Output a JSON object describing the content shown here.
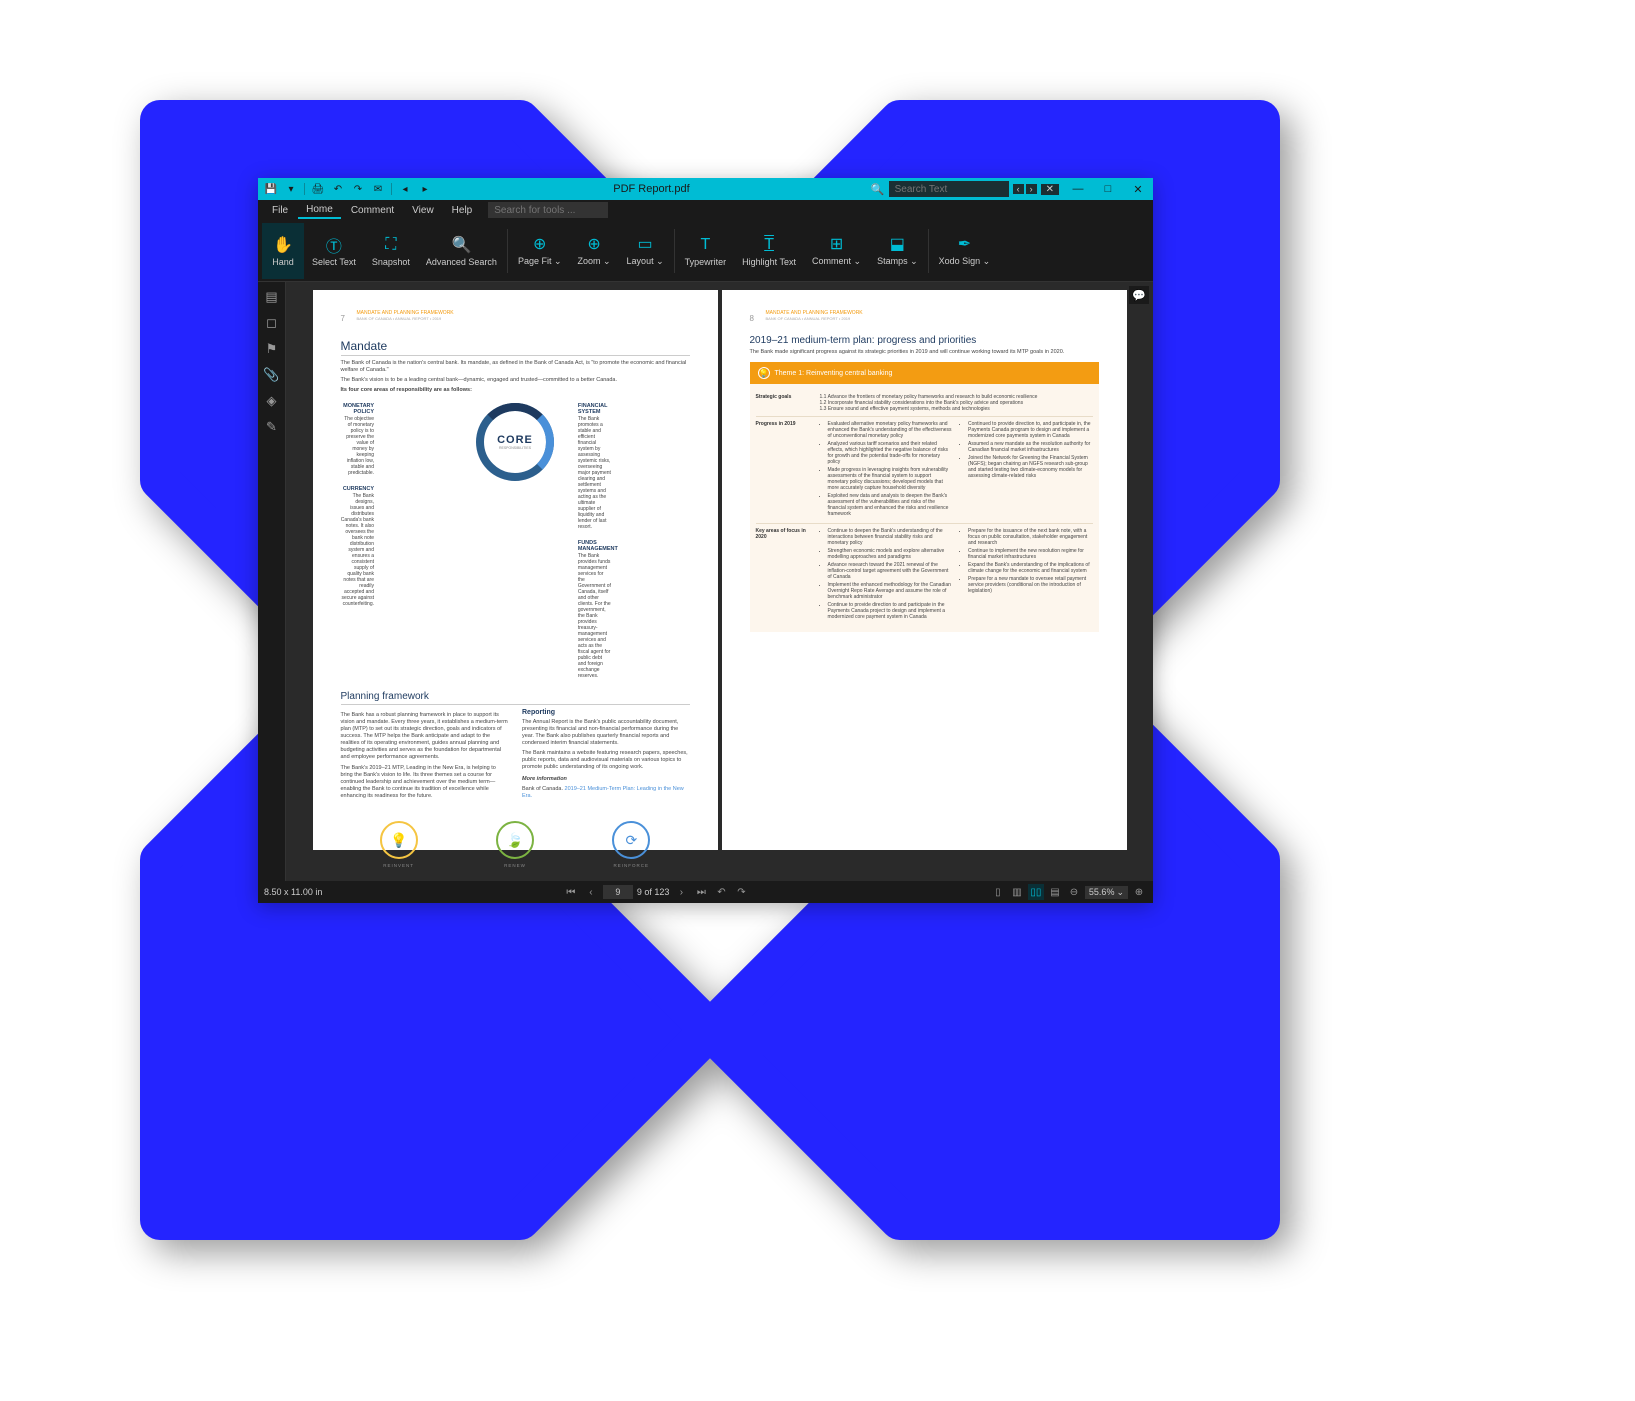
{
  "titlebar": {
    "title": "PDF Report.pdf",
    "search_placeholder": "Search Text"
  },
  "syscontrols": {
    "min": "—",
    "max": "□",
    "close": "✕"
  },
  "menubar": {
    "items": [
      "File",
      "Home",
      "Comment",
      "View",
      "Help"
    ],
    "active": 1,
    "search_placeholder": "Search for tools ..."
  },
  "ribbon": {
    "buttons": [
      {
        "label": "Hand",
        "active": true
      },
      {
        "label": "Select Text"
      },
      {
        "label": "Snapshot"
      },
      {
        "label": "Advanced Search"
      },
      {
        "sep": true
      },
      {
        "label": "Page Fit ⌄"
      },
      {
        "label": "Zoom ⌄"
      },
      {
        "label": "Layout ⌄"
      },
      {
        "sep": true
      },
      {
        "label": "Typewriter"
      },
      {
        "label": "Highlight Text"
      },
      {
        "label": "Comment ⌄"
      },
      {
        "label": "Stamps ⌄"
      },
      {
        "sep": true
      },
      {
        "label": "Xodo Sign ⌄"
      }
    ]
  },
  "page_left": {
    "num": "7",
    "header": "MANDATE AND PLANNING FRAMEWORK",
    "sub": "BANK OF CANADA  •  ANNUAL REPORT  •  2019",
    "h1": "Mandate",
    "p1": "The Bank of Canada is the nation's central bank. Its mandate, as defined in the Bank of Canada Act, is \"to promote the economic and financial welfare of Canada.\"",
    "p2": "The Bank's vision is to be a leading central bank—dynamic, engaged and trusted—committed to a better Canada.",
    "p3": "Its four core areas of responsibility are as follows:",
    "core": {
      "mp_h": "MONETARY POLICY",
      "mp_t": "The objective of monetary policy is to preserve the value of money by keeping inflation low, stable and predictable.",
      "fs_h": "FINANCIAL SYSTEM",
      "fs_t": "The Bank promotes a stable and efficient financial system by assessing systemic risks, overseeing major payment clearing and settlement systems and acting as the ultimate supplier of liquidity and lender of last resort.",
      "cu_h": "CURRENCY",
      "cu_t": "The Bank designs, issues and distributes Canada's bank notes. It also oversees the bank note distribution system and ensures a consistent supply of quality bank notes that are readily accepted and secure against counterfeiting.",
      "fm_h": "FUNDS MANAGEMENT",
      "fm_t": "The Bank provides funds management services for the Government of Canada, itself and other clients. For the government, the Bank provides treasury-management services and acts as the fiscal agent for public debt and foreign exchange reserves.",
      "title": "CORE",
      "sub": "RESPONSIBILITIES"
    },
    "h2": "Planning framework",
    "plan_p1": "The Bank has a robust planning framework in place to support its vision and mandate. Every three years, it establishes a medium-term plan (MTP) to set out its strategic direction, goals and indicators of success. The MTP helps the Bank anticipate and adapt to the realities of its operating environment, guides annual planning and budgeting activities and serves as the foundation for departmental and employee performance agreements.",
    "plan_p2": "The Bank's 2019–21 MTP, Leading in the New Era, is helping to bring the Bank's vision to life. Its three themes set a course for continued leadership and achievement over the medium term—enabling the Bank to continue its tradition of excellence while enhancing its readiness for the future.",
    "rep_h": "Reporting",
    "rep_p1": "The Annual Report is the Bank's public accountability document, presenting its financial and non-financial performance during the year. The Bank also publishes quarterly financial reports and condensed interim financial statements.",
    "rep_p2": "The Bank maintains a website featuring research papers, speeches, public reports, data and audiovisual materials on various topics to promote public understanding of its ongoing work.",
    "more_h": "More information",
    "more_t": "Bank of Canada. ",
    "more_link": "2019–21 Medium-Term Plan: Leading in the New Era.",
    "icons": [
      "REINVENT",
      "RENEW",
      "REINFORCE"
    ]
  },
  "page_right": {
    "num": "8",
    "header": "MANDATE AND PLANNING FRAMEWORK",
    "sub": "BANK OF CANADA  •  ANNUAL REPORT  •  2019",
    "h1": "2019–21 medium-term plan: progress and priorities",
    "p1": "The Bank made significant progress against its strategic priorities in 2019 and will continue working toward its MTP goals in 2020.",
    "theme": "Theme 1: Reinventing central banking",
    "rows": [
      {
        "label": "Strategic goals",
        "single": "1.1 Advance the frontiers of monetary policy frameworks and research to build economic resilience\n1.2 Incorporate financial stability considerations into the Bank's policy advice and operations\n1.3 Ensure sound and effective payment systems, methods and technologies"
      },
      {
        "label": "Progress in 2019",
        "col1": [
          "Evaluated alternative monetary policy frameworks and enhanced the Bank's understanding of the effectiveness of unconventional monetary policy",
          "Analyzed various tariff scenarios and their related effects, which highlighted the negative balance of risks for growth and the potential trade-offs for monetary policy",
          "Made progress in leveraging insights from vulnerability assessments of the financial system to support monetary policy discussions; developed models that more accurately capture household diversity",
          "Exploited new data and analysis to deepen the Bank's assessment of the vulnerabilities and risks of the financial system and enhanced the risks and resilience framework"
        ],
        "col2": [
          "Continued to provide direction to, and participate in, the Payments Canada program to design and implement a modernized core payments system in Canada",
          "Assumed a new mandate as the resolution authority for Canadian financial market infrastructures",
          "Joined the Network for Greening the Financial System (NGFS); began chairing an NGFS research sub-group and started testing two climate-economy models for assessing climate-related risks"
        ]
      },
      {
        "label": "Key areas of focus in 2020",
        "col1": [
          "Continue to deepen the Bank's understanding of the interactions between financial stability risks and monetary policy",
          "Strengthen economic models and explore alternative modelling approaches and paradigms",
          "Advance research toward the 2021 renewal of the inflation-control target agreement with the Government of Canada",
          "Implement the enhanced methodology for the Canadian Overnight Repo Rate Average and assume the role of benchmark administrator",
          "Continue to provide direction to and participate in the Payments Canada project to design and implement a modernized core payment system in Canada"
        ],
        "col2": [
          "Prepare for the issuance of the next bank note, with a focus on public consultation, stakeholder engagement and research",
          "Continue to implement the new resolution regime for financial market infrastructures",
          "Expand the Bank's understanding of the implications of climate change for the economic and financial system",
          "Prepare for a new mandate to oversee retail payment service providers (conditional on the introduction of legislation)"
        ]
      }
    ]
  },
  "statusbar": {
    "dims": "8.50 x 11.00 in",
    "page_input": "9",
    "page_total": "9 of 123",
    "zoom": "55.6%"
  }
}
